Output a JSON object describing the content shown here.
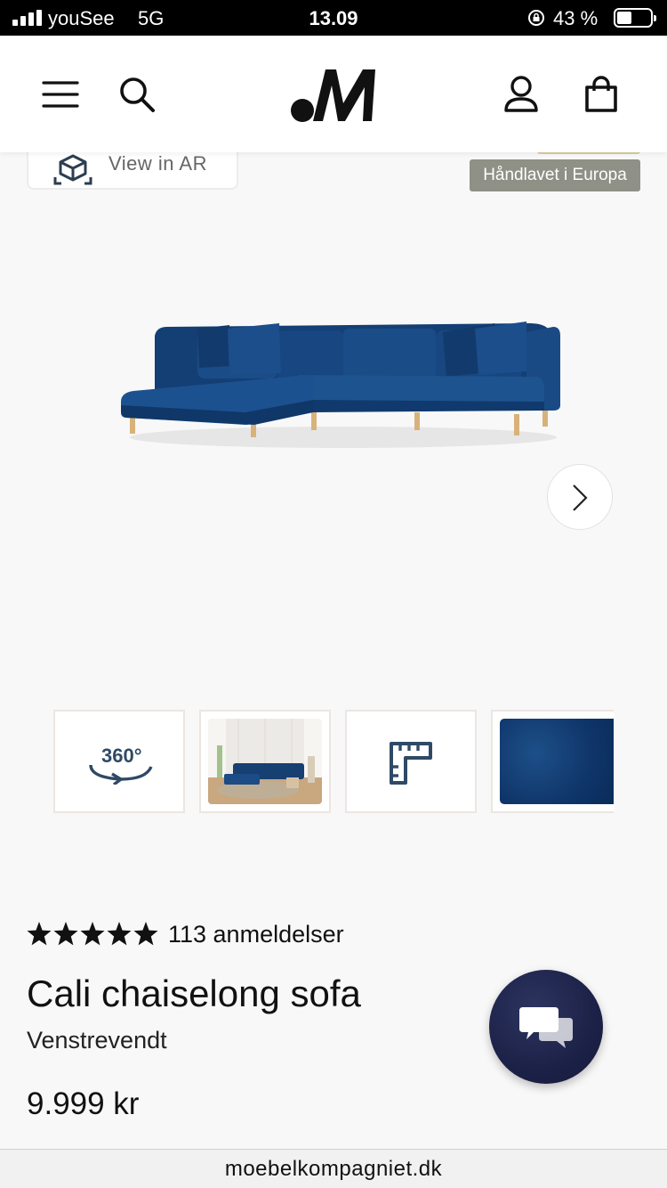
{
  "status_bar": {
    "carrier": "youSee",
    "network": "5G",
    "time": "13.09",
    "battery_percent": "43 %",
    "signal_icon": "cellular-signal-icon",
    "lock_icon": "orientation-lock-icon",
    "battery_icon": "battery-icon"
  },
  "header": {
    "menu_icon": "hamburger-menu-icon",
    "search_icon": "search-icon",
    "logo": "M",
    "account_icon": "user-icon",
    "cart_icon": "shopping-bag-icon"
  },
  "hero": {
    "ar_button_label": "View in AR",
    "badge": "Håndlavet i Europa",
    "next_icon": "chevron-right-icon"
  },
  "thumbnails": [
    {
      "type": "360",
      "label": "360°"
    },
    {
      "type": "room-photo"
    },
    {
      "type": "dimensions",
      "icon": "ruler-icon"
    },
    {
      "type": "fabric-swatch"
    }
  ],
  "product": {
    "rating_stars": 5,
    "review_count": "113 anmeldelser",
    "title": "Cali chaiselong sofa",
    "variant": "Venstrevendt",
    "price": "9.999 kr"
  },
  "chat": {
    "icon": "chat-bubbles-icon"
  },
  "browser": {
    "url": "moebelkompagniet.dk"
  },
  "colors": {
    "sofa_blue": "#0f3a6e",
    "badge_grey": "#8f9086",
    "chat_navy": "#1c2147",
    "gold_accent": "#d8cd98"
  }
}
